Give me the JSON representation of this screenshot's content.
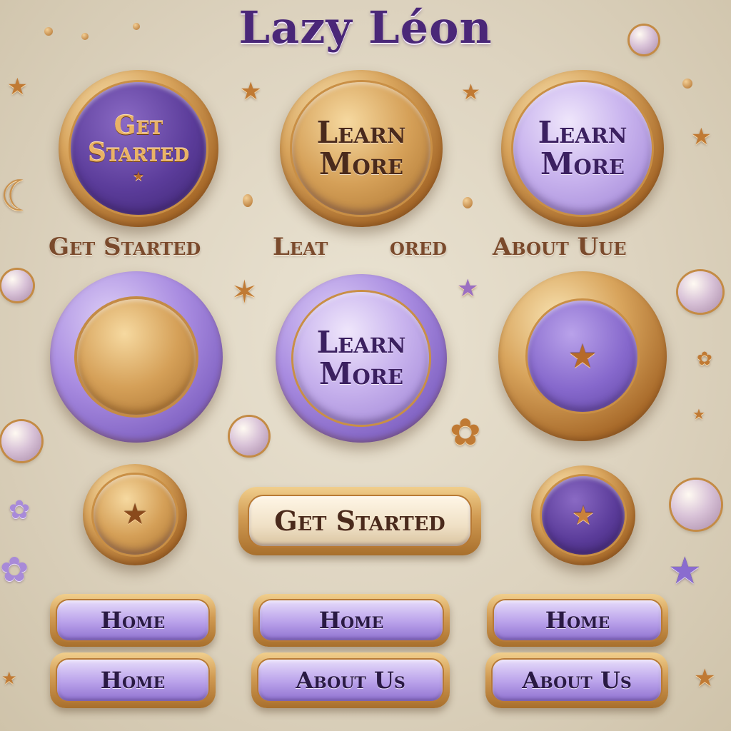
{
  "title": "Lazy Léon",
  "top_row": [
    {
      "text_line1": "Get",
      "text_line2": "Started"
    },
    {
      "text_line1": "Learn",
      "text_line2": "More"
    },
    {
      "text_line1": "Learn",
      "text_line2": "More"
    }
  ],
  "labels": [
    {
      "text": "Get Started"
    },
    {
      "text": "Leat"
    },
    {
      "text": "ored"
    },
    {
      "text": "About Uue"
    }
  ],
  "middle_row": [
    {
      "text_line1": "",
      "text_line2": ""
    },
    {
      "text_line1": "Learn",
      "text_line2": "More"
    },
    {
      "icon": "star-icon"
    }
  ],
  "lower_row": {
    "left_icon": "star-icon",
    "center_label": "Get Started",
    "right_icon": "star-icon"
  },
  "nav_buttons": [
    {
      "label": "Home"
    },
    {
      "label": "Home"
    },
    {
      "label": "Home"
    },
    {
      "label": "Home"
    },
    {
      "label": "About Us"
    },
    {
      "label": "About Us"
    }
  ],
  "colors": {
    "background": "#e3dac6",
    "purple": "#4a2778",
    "lilac": "#b9a1ea",
    "gold": "#d09a52",
    "bronze": "#a86f2c"
  }
}
